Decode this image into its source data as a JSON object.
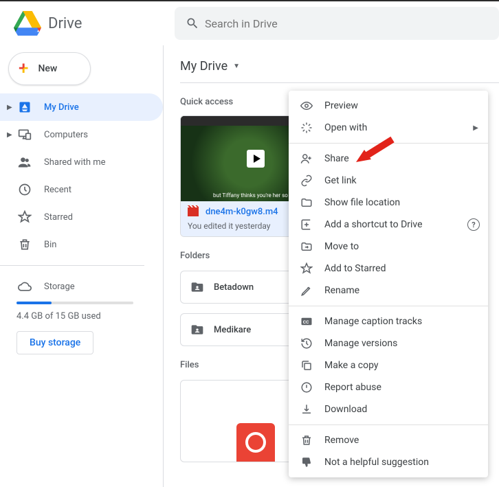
{
  "header": {
    "product": "Drive",
    "search_placeholder": "Search in Drive"
  },
  "sidebar": {
    "new_label": "New",
    "items": [
      {
        "label": "My Drive"
      },
      {
        "label": "Computers"
      },
      {
        "label": "Shared with me"
      },
      {
        "label": "Recent"
      },
      {
        "label": "Starred"
      },
      {
        "label": "Bin"
      }
    ],
    "storage_label": "Storage",
    "storage_used_text": "4.4 GB of 15 GB used",
    "buy_label": "Buy storage"
  },
  "main": {
    "breadcrumb": "My Drive",
    "quick_access_label": "Quick access",
    "qa_file": {
      "name": "dne4m-k0gw8.m4",
      "subtitle": "You edited it yesterday",
      "thumb_caption": "but Tiffany thinks you're her so spo"
    },
    "folders_label": "Folders",
    "folders": [
      {
        "name": "Betadown"
      },
      {
        "name": "Medikare"
      }
    ],
    "files_label": "Files"
  },
  "ctx": {
    "preview": "Preview",
    "open_with": "Open with",
    "share": "Share",
    "get_link": "Get link",
    "show_loc": "Show file location",
    "add_shortcut": "Add a shortcut to Drive",
    "move": "Move to",
    "star": "Add to Starred",
    "rename": "Rename",
    "captions": "Manage caption tracks",
    "versions": "Manage versions",
    "copy": "Make a copy",
    "report": "Report abuse",
    "download": "Download",
    "remove": "Remove",
    "not_helpful": "Not a helpful suggestion"
  }
}
